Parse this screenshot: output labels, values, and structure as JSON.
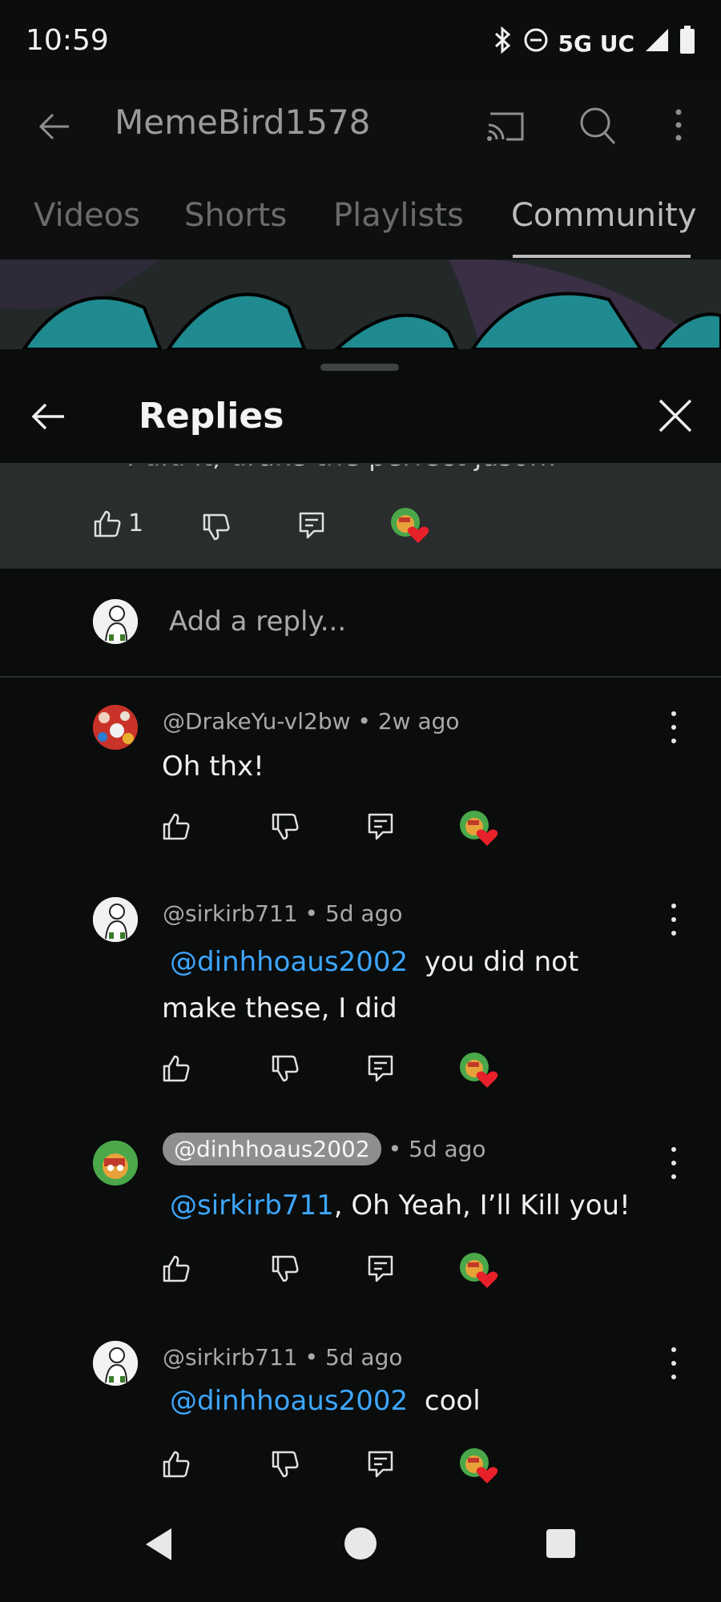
{
  "status_bar": {
    "time": "10:59",
    "network": "5G UC"
  },
  "app_bar": {
    "channel_name": "MemeBird1578"
  },
  "tabs": [
    {
      "label": "Videos",
      "active": false
    },
    {
      "label": "Shorts",
      "active": false
    },
    {
      "label": "Playlists",
      "active": false
    },
    {
      "label": "Community",
      "active": true
    }
  ],
  "sheet": {
    "title": "Replies",
    "parent_comment": {
      "text_partial": "I did it, drake the perfect jason!",
      "likes": "1"
    },
    "reply_placeholder": "Add a reply..."
  },
  "replies": [
    {
      "author": "@DrakeYu-vl2bw",
      "age": "2w ago",
      "text": "Oh thx!",
      "mention": ""
    },
    {
      "author": "@sirkirb711",
      "age": "5d ago",
      "mention": "@dinhhoaus2002",
      "text_line1": "you did not",
      "text_line2": "make these, I did"
    },
    {
      "author": "@dinhhoaus2002",
      "age": "5d ago",
      "mention": "@sirkirb711",
      "text": ", Oh Yeah, I’ll Kill you!",
      "is_creator_chip": true
    },
    {
      "author": "@sirkirb711",
      "age": "5d ago",
      "mention": "@dinhhoaus2002",
      "text": "cool"
    }
  ],
  "colors": {
    "background": "#0a0d0c",
    "mention": "#3ea6ff",
    "heart": "#e8202a"
  },
  "icons": [
    "back-arrow-icon",
    "cast-icon",
    "search-icon",
    "more-vert-icon",
    "close-icon",
    "thumbs-up-icon",
    "thumbs-down-icon",
    "reply-icon",
    "creator-heart-icon",
    "nav-back-icon",
    "nav-home-icon",
    "nav-recents-icon"
  ]
}
